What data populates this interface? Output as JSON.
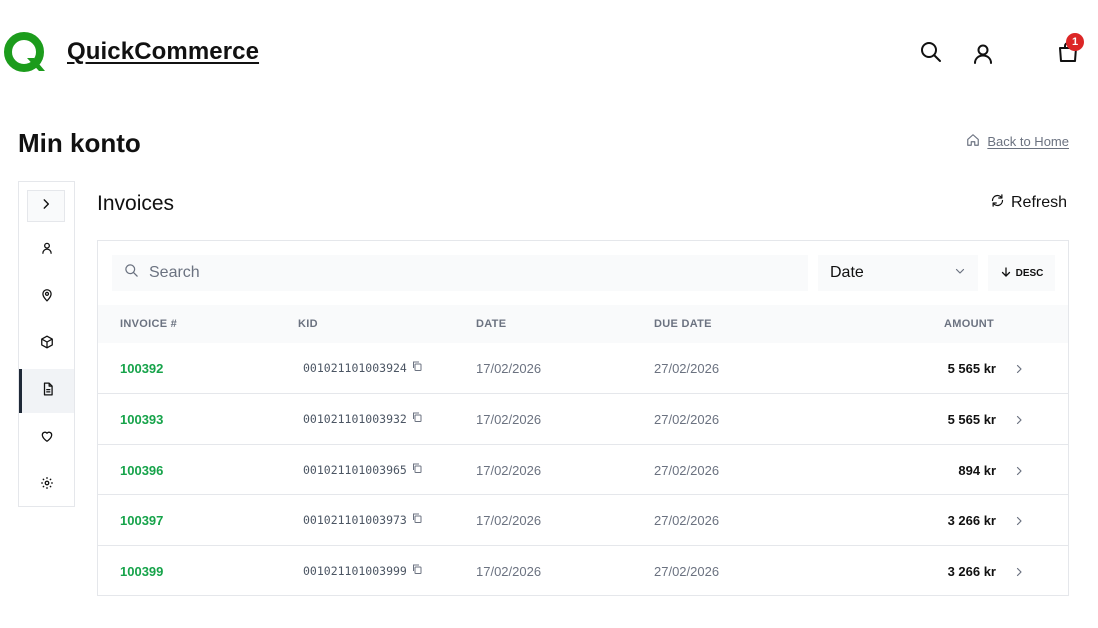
{
  "header": {
    "brand": "QuickCommerce",
    "brand_color": "#1c9c1c",
    "cart_count": "1",
    "icons": [
      "search-icon",
      "user-icon",
      "shopping-bag-icon"
    ]
  },
  "page": {
    "title": "Min konto",
    "back_link": "Back to Home"
  },
  "sidebar": {
    "items": [
      {
        "icon": "chevron-right-icon"
      },
      {
        "icon": "user-icon"
      },
      {
        "icon": "map-pin-icon"
      },
      {
        "icon": "package-icon"
      },
      {
        "icon": "invoice-icon",
        "active": true
      },
      {
        "icon": "heart-icon"
      },
      {
        "icon": "gear-icon"
      }
    ]
  },
  "invoices": {
    "title": "Invoices",
    "refresh_label": "Refresh",
    "search_placeholder": "Search",
    "sort_field": "Date",
    "sort_dir": "DESC",
    "columns": [
      "INVOICE #",
      "KID",
      "DATE",
      "DUE DATE",
      "AMOUNT"
    ],
    "rows": [
      {
        "number": "100392",
        "kid": "001021101003924",
        "date": "17/02/2026",
        "due": "27/02/2026",
        "amount": "5 565 kr"
      },
      {
        "number": "100393",
        "kid": "001021101003932",
        "date": "17/02/2026",
        "due": "27/02/2026",
        "amount": "5 565 kr"
      },
      {
        "number": "100396",
        "kid": "001021101003965",
        "date": "17/02/2026",
        "due": "27/02/2026",
        "amount": "894 kr"
      },
      {
        "number": "100397",
        "kid": "001021101003973",
        "date": "17/02/2026",
        "due": "27/02/2026",
        "amount": "3 266 kr"
      },
      {
        "number": "100399",
        "kid": "001021101003999",
        "date": "17/02/2026",
        "due": "27/02/2026",
        "amount": "3 266 kr"
      }
    ]
  },
  "colors": {
    "accent_green": "#16a34a",
    "badge_red": "#dc2626",
    "border": "#e5e7eb",
    "muted_text": "#6b7280"
  }
}
